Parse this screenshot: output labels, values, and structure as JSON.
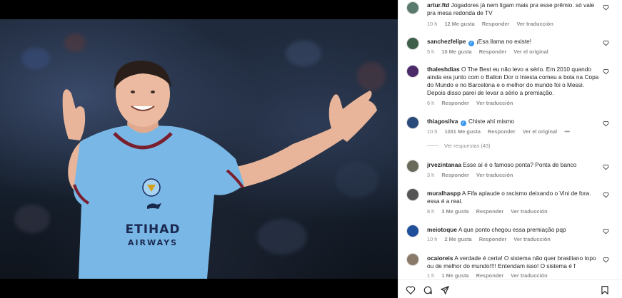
{
  "post": {
    "image_alt": "Football player in light blue jersey celebrating",
    "jersey_sponsor": "ETIHAD",
    "jersey_sponsor_sub": "AIRWAYS",
    "kit_brand": "PUMA"
  },
  "comments": [
    {
      "username": "artur.ftd",
      "verified": false,
      "text": "Jogadores já nem ligam mais pra esse prêmio. só vale pra mesa redonda de TV",
      "time": "10 h",
      "likes": "12 Me gusta",
      "reply": "Responder",
      "extra": "Ver traducción",
      "avatar_color": "#5b7a6e"
    },
    {
      "username": "sanchezfelipe",
      "verified": true,
      "text": "¡Esa llama no existe!",
      "time": "5 h",
      "likes": "10 Me gusta",
      "reply": "Responder",
      "extra": "Ver el original",
      "avatar_color": "#3f5f4a"
    },
    {
      "username": "thaleshdias",
      "verified": false,
      "text": "O The Best eu não levo a sério. Em 2010 quando ainda era junto com o Ballon Dor o Iniesta comeu a bola na Copa do Mundo e no Barcelona e o melhor do mundo foi o Messi. Depois disso parei de levar a sério a premiação.",
      "time": "6 h",
      "likes": "",
      "reply": "Responder",
      "extra": "Ver traducción",
      "avatar_color": "#4b2a6a"
    },
    {
      "username": "thiagosilva",
      "verified": true,
      "text": "Chiste ahí mismo",
      "time": "10 h",
      "likes": "1031 Me gusta",
      "reply": "Responder",
      "extra": "Ver el original",
      "more": "•••",
      "replies_label": "Ver respuestas (43)",
      "avatar_color": "#2a4a7a"
    },
    {
      "username": "jrvezintanaa",
      "verified": false,
      "text": "Esse aí é o famoso ponta? Ponta de banco",
      "time": "3 h",
      "likes": "",
      "reply": "Responder",
      "extra": "Ver traducción",
      "avatar_color": "#6a6a5a"
    },
    {
      "username": "muralhaspp",
      "verified": false,
      "text": "A Fifa aplaude o racismo deixando o Vini de fora. essa é a real.",
      "time": "8 h",
      "likes": "3 Me gusta",
      "reply": "Responder",
      "extra": "Ver traducción",
      "avatar_color": "#555555"
    },
    {
      "username": "meiotoque",
      "verified": false,
      "text": "A que ponto chegou essa premiação pqp",
      "time": "10 h",
      "likes": "2 Me gusta",
      "reply": "Responder",
      "extra": "Ver traducción",
      "avatar_color": "#1f4e9a"
    },
    {
      "username": "ocaioreis",
      "verified": false,
      "text": "A verdade é certa! O sistema não quer brasiliano topo ou de melhor do mundo!!!! Entendam isso! O sistema é f",
      "time": "1 h",
      "likes": "1 Me gusta",
      "reply": "Responder",
      "extra": "Ver traducción",
      "avatar_color": "#8a7a6a"
    }
  ],
  "actions": {
    "like": "heart-icon",
    "comment": "comment-icon",
    "share": "share-icon",
    "save": "bookmark-icon"
  },
  "colors": {
    "jersey": "#79b8e6",
    "jersey_trim": "#7a1f2e",
    "verified": "#3897f0",
    "meta_text": "#8e8e8e"
  }
}
